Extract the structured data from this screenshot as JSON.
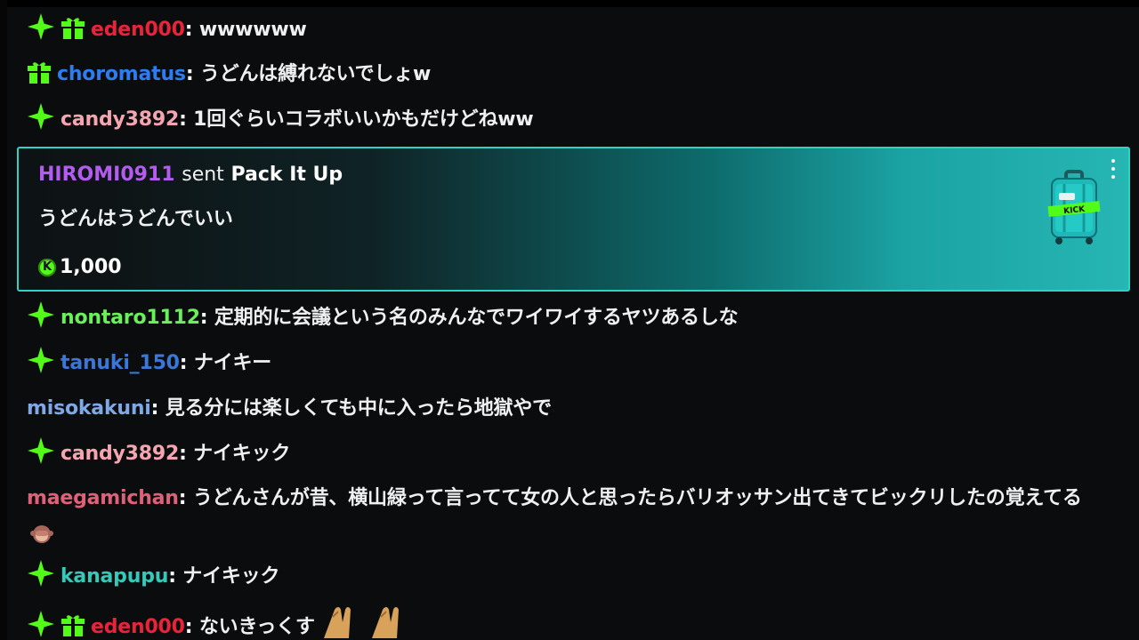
{
  "chat": {
    "messages": [
      {
        "badges": [
          "sparkle",
          "gift"
        ],
        "username": "eden000",
        "color": "#e8233a",
        "text": "wwwwww"
      },
      {
        "badges": [
          "gift"
        ],
        "username": "choromatus",
        "color": "#2d7df0",
        "text": "うどんは縛れないでしょw"
      },
      {
        "badges": [
          "sparkle"
        ],
        "username": "candy3892",
        "color": "#f4a6b0",
        "text": "1回ぐらいコラボいいかもだけどねww"
      },
      {
        "badges": [
          "sparkle"
        ],
        "username": "nontaro1112",
        "color": "#6af05a",
        "text": "定期的に会議という名のみんなでワイワイするヤツあるしな"
      },
      {
        "badges": [
          "sparkle"
        ],
        "username": "tanuki_150",
        "color": "#3a78d8",
        "text": "ナイキー"
      },
      {
        "badges": [],
        "username": "misokakuni",
        "color": "#7fa8e6",
        "text": "見る分には楽しくても中に入ったら地獄やで"
      },
      {
        "badges": [
          "sparkle"
        ],
        "username": "candy3892",
        "color": "#f4a6b0",
        "text": "ナイキック"
      },
      {
        "badges": [],
        "username": "maegamichan",
        "color": "#e0607a",
        "text": "うどんさんが昔、横山緑って言ってて女の人と思ったらバリオッサン出てきてビックリしたの覚えてる",
        "emote": "see-no-evil-monkey"
      },
      {
        "badges": [
          "sparkle"
        ],
        "username": "kanapupu",
        "color": "#36c8b8",
        "text": "ナイキック"
      },
      {
        "badges": [
          "sparkle",
          "gift"
        ],
        "username": "eden000",
        "color": "#e8233a",
        "text": "ないきっくす",
        "emote": "praying-hands"
      }
    ]
  },
  "gift_card": {
    "username": "HIROMI0911",
    "username_color": "#b45cf0",
    "sent_label": "sent",
    "gift_name": "Pack It Up",
    "message": "うどんはうどんでいい",
    "amount": "1,000",
    "coin_symbol": "K",
    "gift_image": "kick-suitcase",
    "border_color": "#2fd3c6"
  },
  "colors": {
    "background": "#0b0c0e",
    "sparkle_badge": "#53fc18",
    "gift_badge": "#53fc18"
  }
}
